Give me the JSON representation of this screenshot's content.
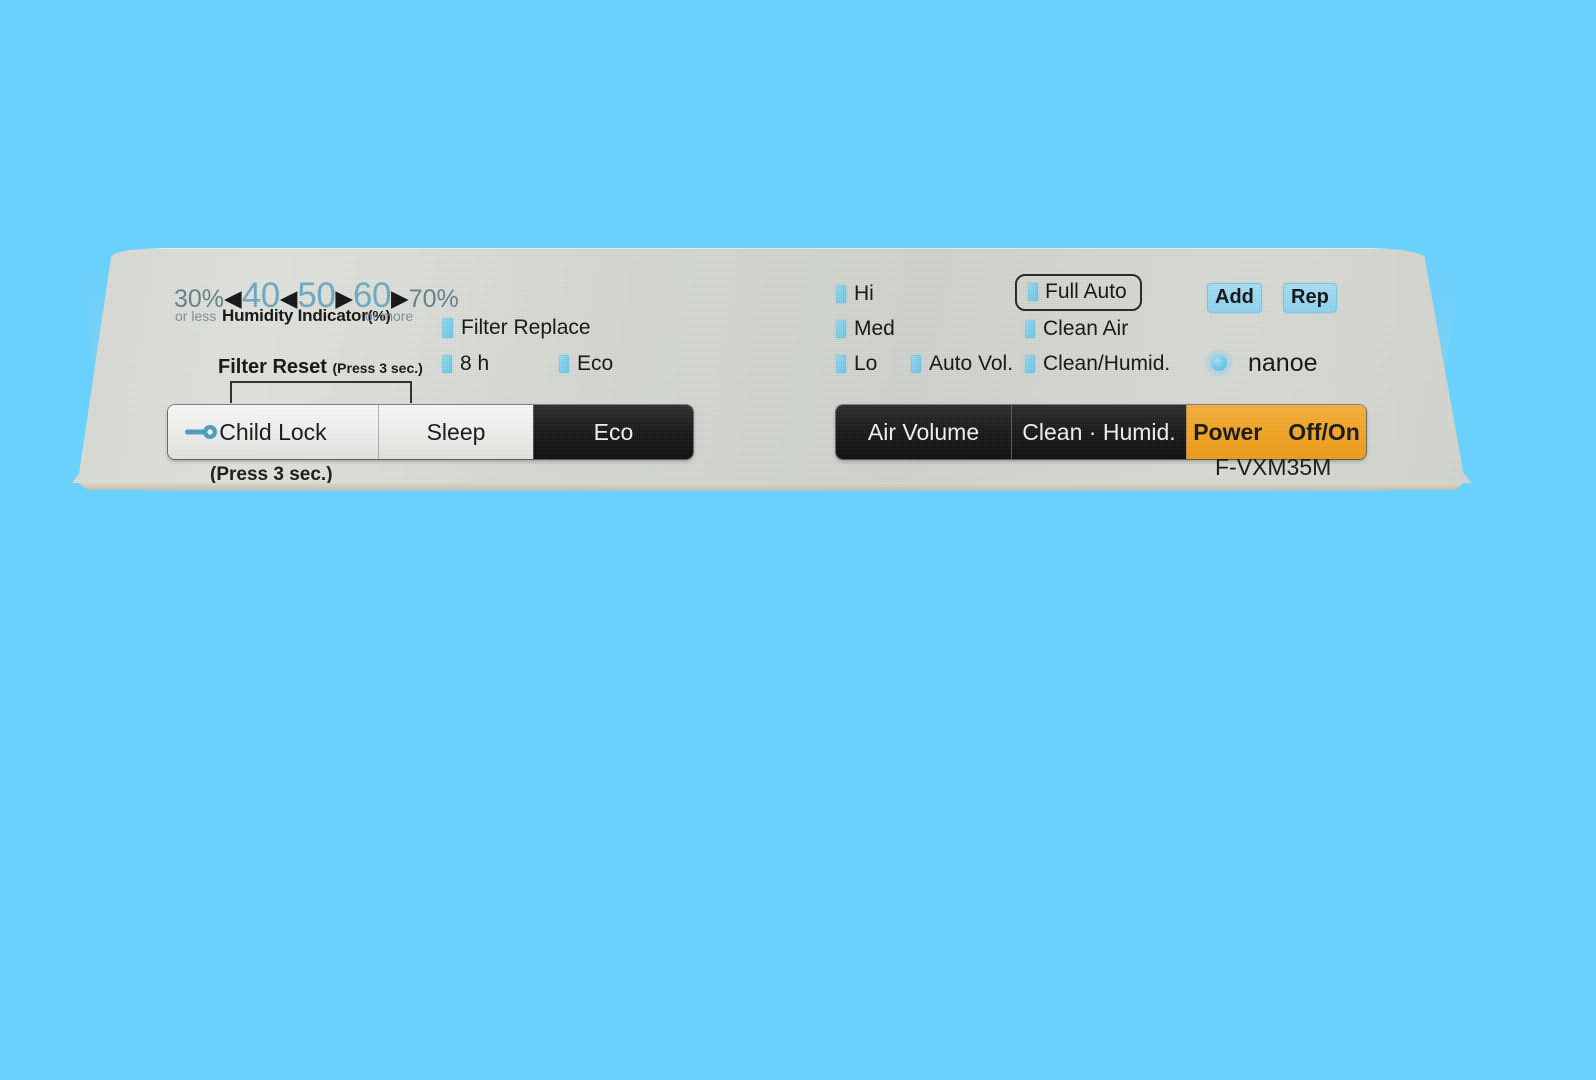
{
  "device": {
    "model_number": "F-VXM35M",
    "background_color": "#6ad0fc",
    "panel_color": "#d8dbd5",
    "accent_led_color": "#7fd2ef",
    "power_button_color": "#f6a622"
  },
  "humidity_indicator": {
    "caption": "Humidity Indicator",
    "caption_unit": "(%)",
    "low_end_value": "30%",
    "low_end_note": "or less",
    "high_end_value": "70%",
    "high_end_note": "or more",
    "scale_values": [
      "40",
      "50",
      "60"
    ],
    "arrows": [
      "◀",
      "◀",
      "▶",
      "▶"
    ]
  },
  "filter_reset": {
    "label": "Filter Reset",
    "hint": "(Press 3 sec.)"
  },
  "left_indicators": [
    {
      "label": "Filter Replace",
      "led": true
    },
    {
      "label": "8 h",
      "led": true
    },
    {
      "label": "Eco",
      "led": true
    }
  ],
  "fan_speed_indicators": [
    {
      "label": "Hi",
      "led": true
    },
    {
      "label": "Med",
      "led": true
    },
    {
      "label": "Lo",
      "led": true
    }
  ],
  "auto_volume_indicator": {
    "label": "Auto Vol.",
    "led": true
  },
  "mode_indicators": [
    {
      "label": "Full Auto",
      "led": true,
      "boxed": true
    },
    {
      "label": "Clean Air",
      "led": true
    },
    {
      "label": "Clean/Humid.",
      "led": true
    }
  ],
  "tank_tags": [
    {
      "label": "Add",
      "name": "add-water-tag"
    },
    {
      "label": "Rep",
      "name": "replenish-tag"
    }
  ],
  "nanoe": {
    "label": "nanoe",
    "icon": "nanoe-glow-icon"
  },
  "left_buttons": [
    {
      "label": "Child Lock",
      "style": "light",
      "icon": "key-icon"
    },
    {
      "label": "Sleep",
      "style": "light",
      "icon": null
    },
    {
      "label": "Eco",
      "style": "dark",
      "icon": null
    }
  ],
  "left_buttons_hint": "(Press 3 sec.)",
  "right_buttons": [
    {
      "label": "Air Volume",
      "style": "dark"
    },
    {
      "label": "Clean · Humid.",
      "style": "dark"
    },
    {
      "label": "Power",
      "secondary_label": "Off/On",
      "style": "orange"
    }
  ]
}
